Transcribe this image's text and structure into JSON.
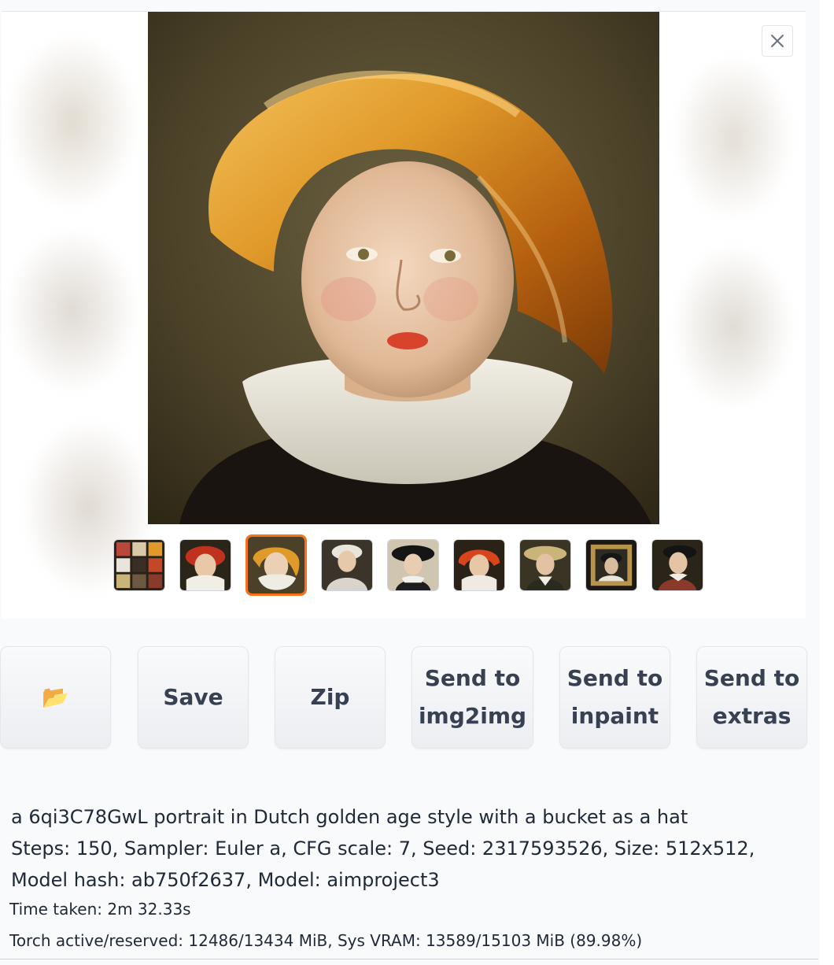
{
  "gallery": {
    "close_icon": "close-icon",
    "thumbnails": [
      {
        "name": "thumb-grid"
      },
      {
        "name": "thumb-red-hat"
      },
      {
        "name": "thumb-gold-bonnet",
        "selected": true
      },
      {
        "name": "thumb-white-cap"
      },
      {
        "name": "thumb-black-hat"
      },
      {
        "name": "thumb-red-scarf"
      },
      {
        "name": "thumb-straw-hat"
      },
      {
        "name": "thumb-framed"
      },
      {
        "name": "thumb-dark-hat"
      }
    ]
  },
  "buttons": {
    "folder_icon": "📂",
    "save": "Save",
    "zip": "Zip",
    "send_img2img": "Send to\nimg2img",
    "send_inpaint": "Send to\ninpaint",
    "send_extras": "Send to\nextras"
  },
  "info": {
    "prompt": "a 6qi3C78GwL portrait in Dutch golden age style with a bucket as a hat",
    "params": "Steps: 150, Sampler: Euler a, CFG scale: 7, Seed: 2317593526, Size: 512x512, Model hash: ab750f2637, Model: aimproject3",
    "time_taken": "Time taken: 2m 32.33s",
    "vram": "Torch active/reserved: 12486/13434 MiB, Sys VRAM: 13589/15103 MiB (89.98%)"
  },
  "colors": {
    "selected_border": "#f97316",
    "button_text": "#374151"
  }
}
